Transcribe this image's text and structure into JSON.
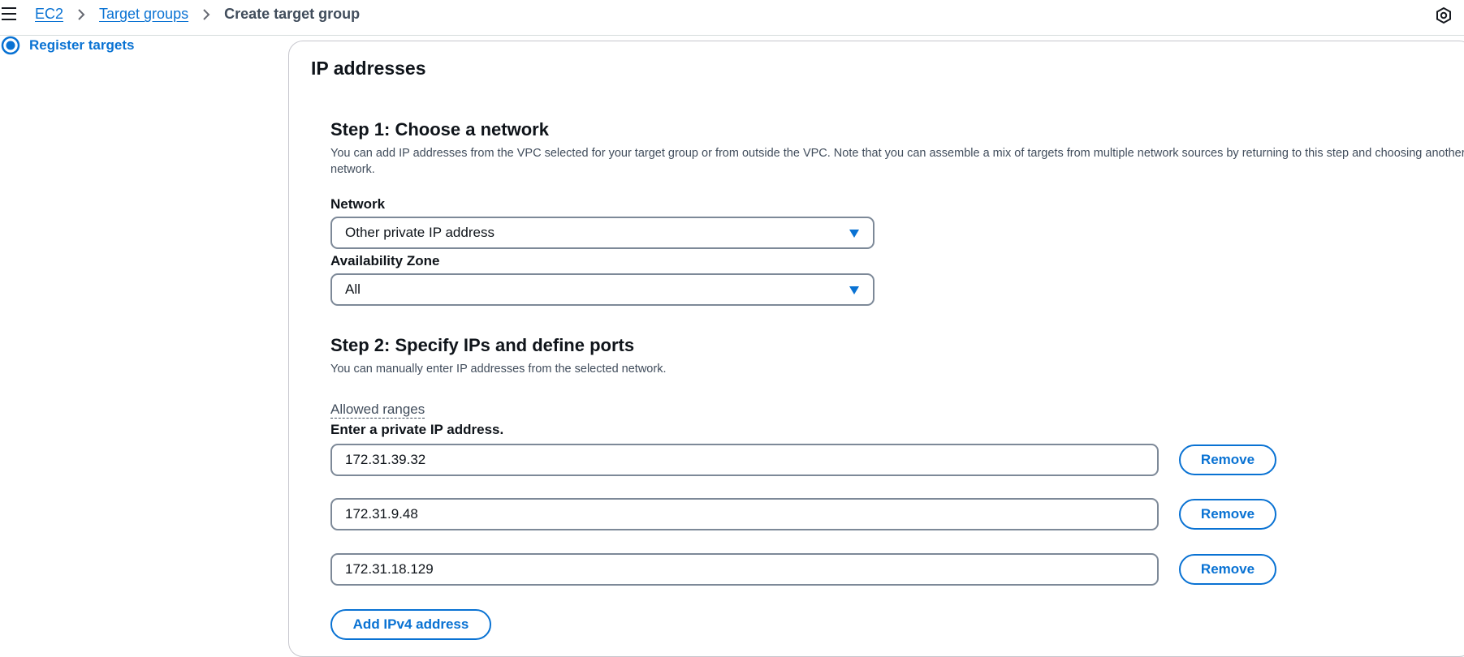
{
  "breadcrumb": {
    "items": [
      "EC2",
      "Target groups"
    ],
    "current": "Create target group"
  },
  "sidenav": {
    "current_step": "Register targets"
  },
  "panel": {
    "title": "IP addresses",
    "step1": {
      "title": "Step 1: Choose a network",
      "description": "You can add IP addresses from the VPC selected for your target group or from outside the VPC. Note that you can assemble a mix of targets from multiple network sources by returning to this step and choosing another network.",
      "network_label": "Network",
      "network_value": "Other private IP address",
      "az_label": "Availability Zone",
      "az_value": "All"
    },
    "step2": {
      "title": "Step 2: Specify IPs and define ports",
      "description": "You can manually enter IP addresses from the selected network.",
      "allowed_ranges_link": "Allowed ranges",
      "ip_label": "Enter a private IP address.",
      "ip_values": [
        "172.31.39.32",
        "172.31.9.48",
        "172.31.18.129"
      ],
      "remove_label": "Remove",
      "add_label": "Add IPv4 address"
    }
  },
  "colors": {
    "link": "#0972d3",
    "text": "#0f141a",
    "secondary_text": "#414d5c",
    "input_border": "#7d8998"
  },
  "icons": [
    "menu-icon",
    "chevron-right-icon",
    "settings-hexagon-icon",
    "radio-selected-icon",
    "caret-down-icon"
  ]
}
